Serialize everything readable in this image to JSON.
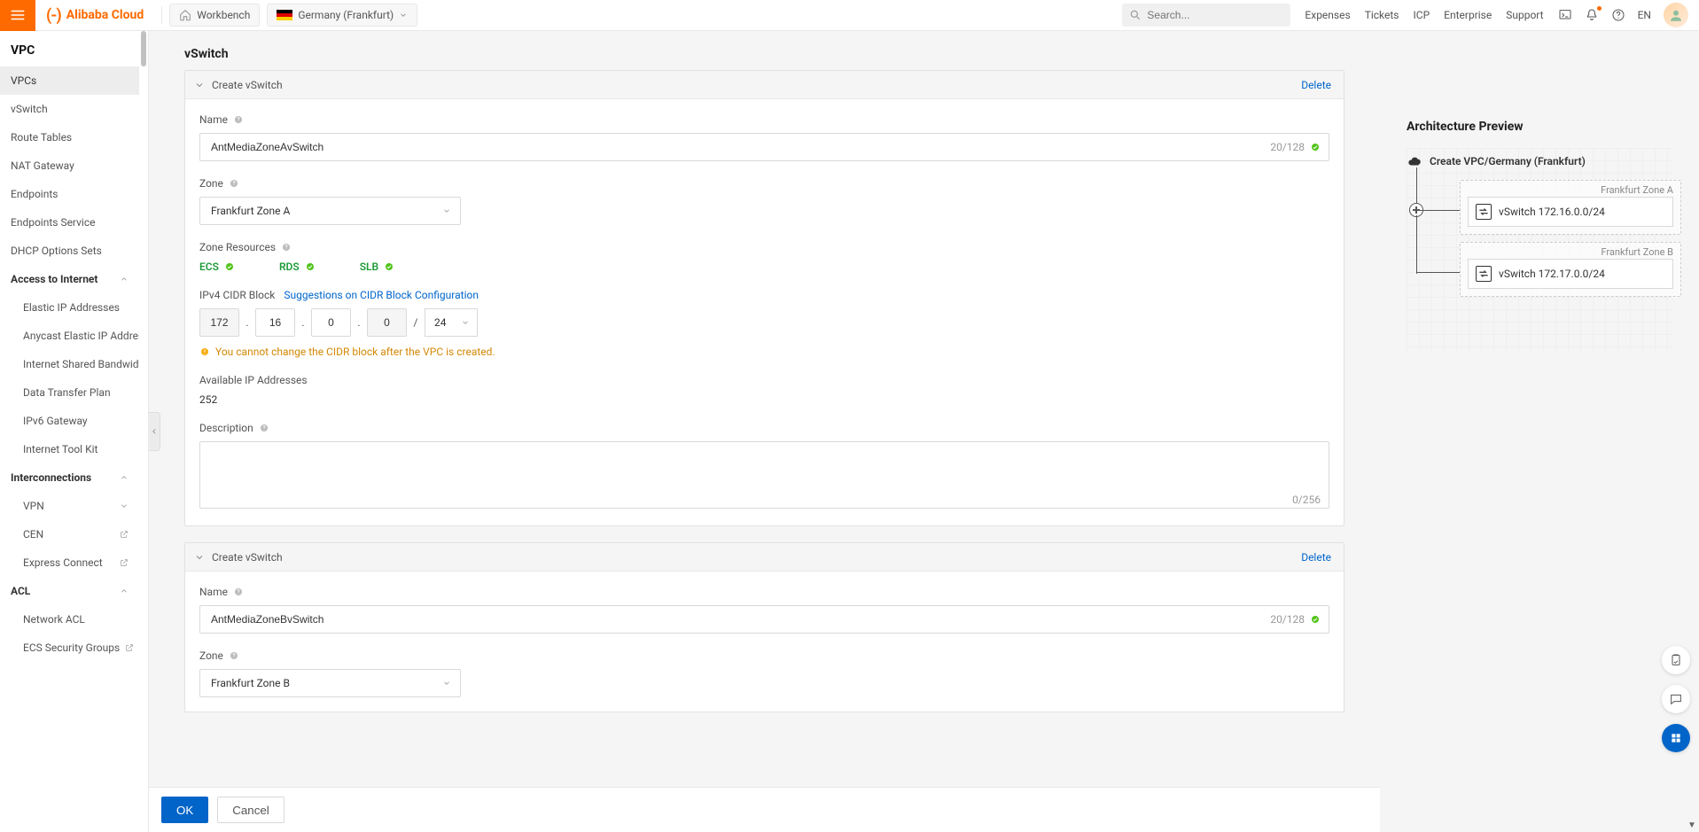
{
  "topbar": {
    "brand": "Alibaba Cloud",
    "workbench": "Workbench",
    "region": "Germany (Frankfurt)",
    "search_placeholder": "Search...",
    "links": [
      "Expenses",
      "Tickets",
      "ICP",
      "Enterprise",
      "Support"
    ],
    "lang": "EN"
  },
  "sidebar": {
    "title": "VPC",
    "items": [
      {
        "label": "VPCs",
        "type": "item",
        "active": true
      },
      {
        "label": "vSwitch",
        "type": "item"
      },
      {
        "label": "Route Tables",
        "type": "item"
      },
      {
        "label": "NAT Gateway",
        "type": "item"
      },
      {
        "label": "Endpoints",
        "type": "item"
      },
      {
        "label": "Endpoints Service",
        "type": "item"
      },
      {
        "label": "DHCP Options Sets",
        "type": "item"
      },
      {
        "label": "Access to Internet",
        "type": "group"
      },
      {
        "label": "Elastic IP Addresses",
        "type": "sub"
      },
      {
        "label": "Anycast Elastic IP Addresses",
        "type": "sub"
      },
      {
        "label": "Internet Shared Bandwidth",
        "type": "sub"
      },
      {
        "label": "Data Transfer Plan",
        "type": "sub"
      },
      {
        "label": "IPv6 Gateway",
        "type": "sub"
      },
      {
        "label": "Internet Tool Kit",
        "type": "sub"
      },
      {
        "label": "Interconnections",
        "type": "group"
      },
      {
        "label": "VPN",
        "type": "sub",
        "expandable": true
      },
      {
        "label": "CEN",
        "type": "sub",
        "ext": true
      },
      {
        "label": "Express Connect",
        "type": "sub",
        "ext": true
      },
      {
        "label": "ACL",
        "type": "group"
      },
      {
        "label": "Network ACL",
        "type": "sub"
      },
      {
        "label": "ECS Security Groups",
        "type": "sub",
        "ext": true
      }
    ]
  },
  "form": {
    "section_title": "vSwitch",
    "panels_title": "Create vSwitch",
    "delete": "Delete",
    "labels": {
      "name": "Name",
      "zone": "Zone",
      "zone_resources": "Zone Resources",
      "ipv4": "IPv4 CIDR Block",
      "cidr_suggest": "Suggestions on CIDR Block Configuration",
      "available_ip": "Available IP Addresses",
      "description": "Description"
    },
    "warning": "You cannot change the CIDR block after the VPC is created.",
    "resources": [
      "ECS",
      "RDS",
      "SLB"
    ],
    "switches": [
      {
        "name": "AntMediaZoneAvSwitch",
        "name_counter": "20/128",
        "zone": "Frankfurt Zone A",
        "cidr": {
          "o1": "172",
          "o2": "16",
          "o3": "0",
          "o4": "0",
          "mask": "24"
        },
        "available_ips": "252",
        "desc": "",
        "desc_counter": "0/256"
      },
      {
        "name": "AntMediaZoneBvSwitch",
        "name_counter": "20/128",
        "zone": "Frankfurt Zone B"
      }
    ]
  },
  "footer": {
    "ok": "OK",
    "cancel": "Cancel"
  },
  "preview": {
    "title": "Architecture Preview",
    "vpc_label": "Create VPC/Germany (Frankfurt)",
    "zone_a_label": "Frankfurt Zone A",
    "zone_b_label": "Frankfurt Zone B",
    "switch_a": "vSwitch 172.16.0.0/24",
    "switch_b": "vSwitch 172.17.0.0/24"
  }
}
